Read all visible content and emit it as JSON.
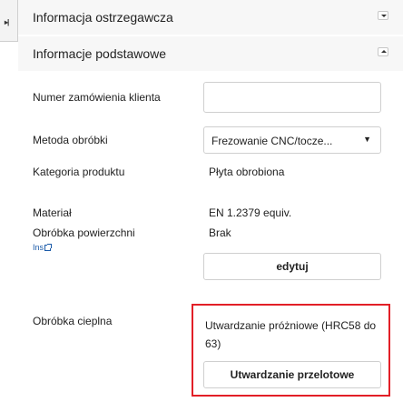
{
  "sidebar_toggle": {
    "glyph": "▸|"
  },
  "warning_section": {
    "title": "Informacja ostrzegawcza",
    "toggle_icon": "caret-down-icon"
  },
  "basic_section": {
    "title": "Informacje podstawowe",
    "toggle_icon": "caret-up-icon"
  },
  "fields": {
    "order_number": {
      "label": "Numer zamówienia klienta",
      "value": ""
    },
    "machining_method": {
      "label": "Metoda obróbki",
      "value": "Frezowanie CNC/tocze...",
      "chevron": "▼"
    },
    "product_category": {
      "label": "Kategoria produktu",
      "value": "Płyta obrobiona"
    },
    "material": {
      "label": "Materiał",
      "value": "EN 1.2379 equiv."
    },
    "surface_treatment": {
      "label": "Obróbka powierzchni",
      "value": "Brak",
      "link": "Ins"
    },
    "heat_treatment": {
      "label": "Obróbka cieplna",
      "value": "Utwardzanie próżniowe (HRC58 do 63)"
    }
  },
  "buttons": {
    "edit": "edytuj",
    "through_hardening": "Utwardzanie przelotowe"
  },
  "colors": {
    "highlight": "#e21f27",
    "link": "#1a5aa8"
  }
}
